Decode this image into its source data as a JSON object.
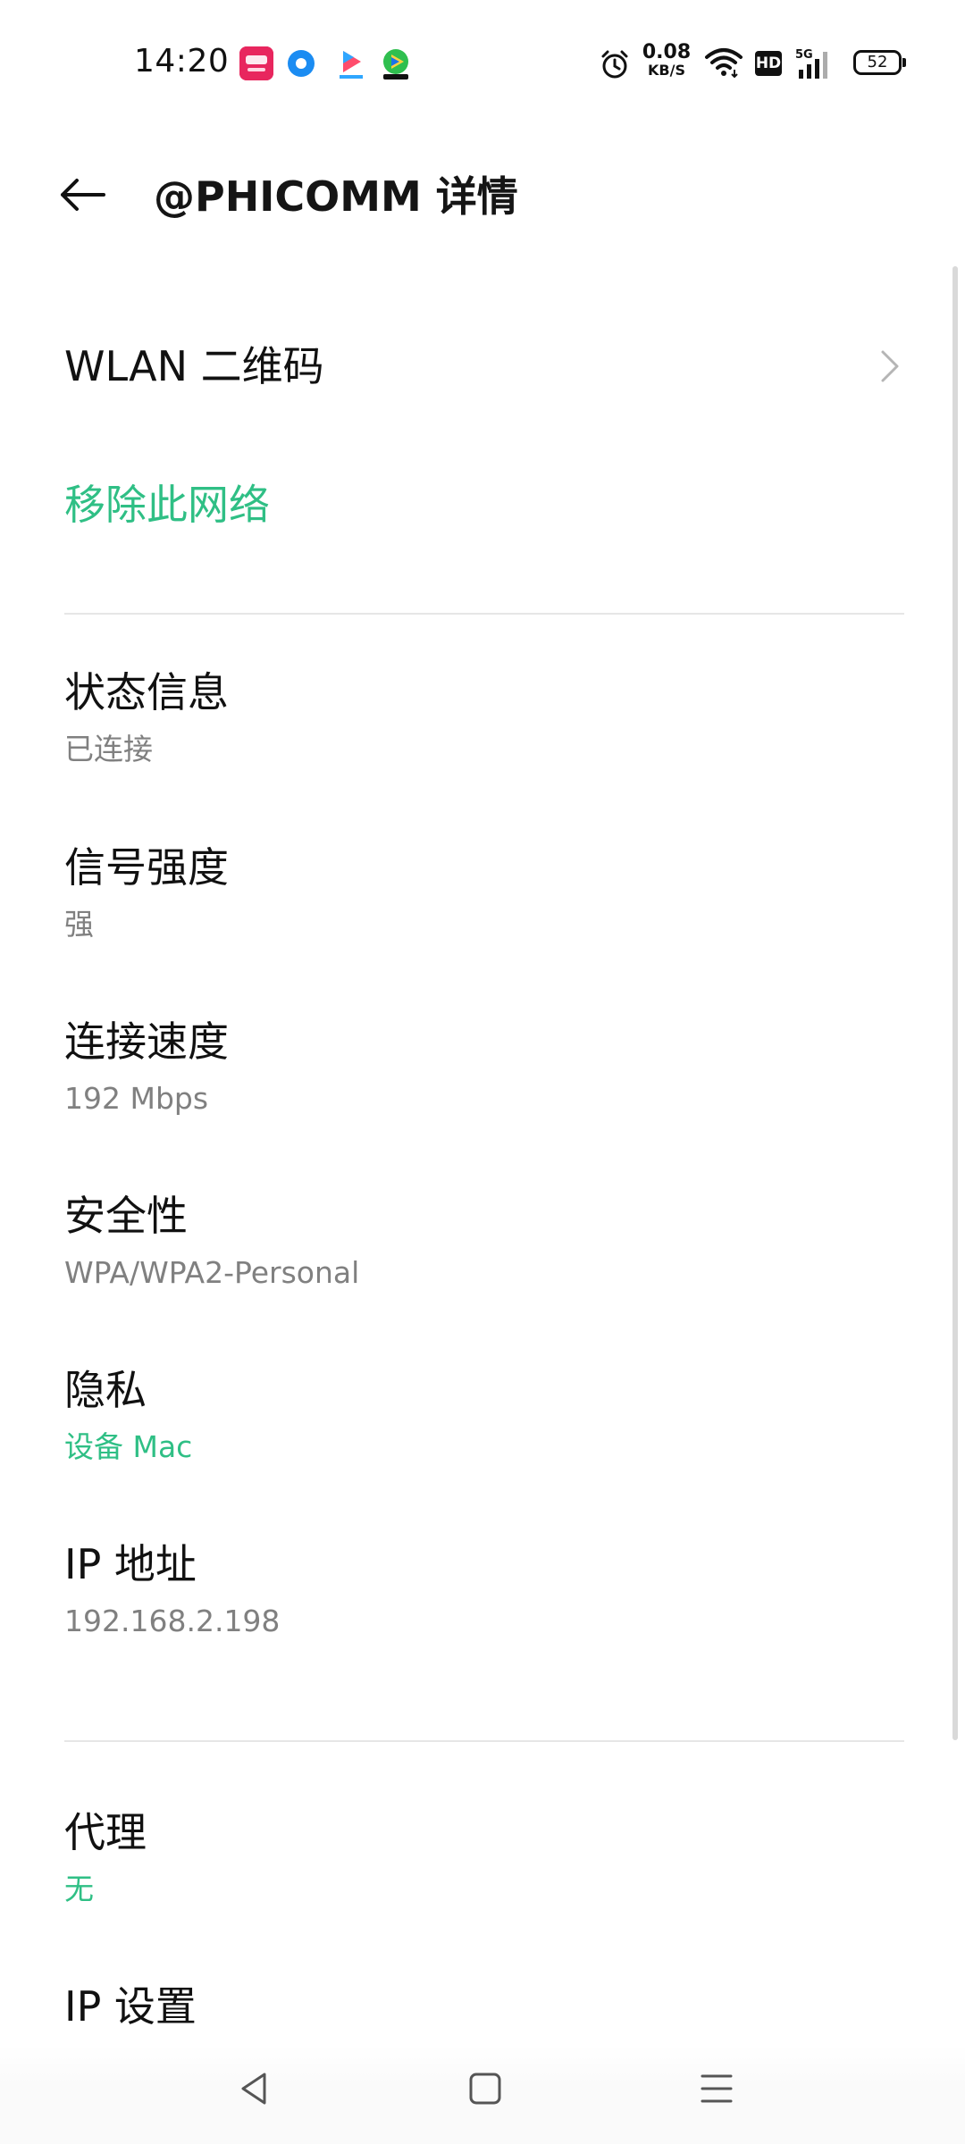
{
  "status_bar": {
    "time": "14:20",
    "net_speed_value": "0.08",
    "net_speed_unit": "KB/S",
    "hd_label": "HD",
    "network_type": "5G",
    "battery_level": "52",
    "icons": [
      "vipshop-app-icon",
      "circle-app-icon",
      "youku-app-icon",
      "tencent-video-app-icon",
      "alarm-icon",
      "wifi-icon",
      "hd-icon",
      "signal-5g-icon",
      "battery-icon"
    ]
  },
  "header": {
    "title": "@PHICOMM 详情",
    "back_icon": "arrow-left-icon"
  },
  "wlan_qr": {
    "label": "WLAN 二维码",
    "icon": "chevron-right-icon"
  },
  "remove_network": {
    "label": "移除此网络",
    "color": "#2fbf85"
  },
  "details": [
    {
      "title": "状态信息",
      "value": "已连接"
    },
    {
      "title": "信号强度",
      "value": "强"
    },
    {
      "title": "连接速度",
      "value": "192 Mbps"
    },
    {
      "title": "安全性",
      "value": "WPA/WPA2-Personal"
    },
    {
      "title": "隐私",
      "value": "设备 Mac"
    },
    {
      "title": "IP 地址",
      "value": "192.168.2.198"
    }
  ],
  "advanced": [
    {
      "title": "代理",
      "value": "无"
    },
    {
      "title": "IP 设置"
    }
  ],
  "nav_bar": {
    "icons": [
      "nav-back-icon",
      "nav-home-icon",
      "nav-recents-icon"
    ]
  }
}
